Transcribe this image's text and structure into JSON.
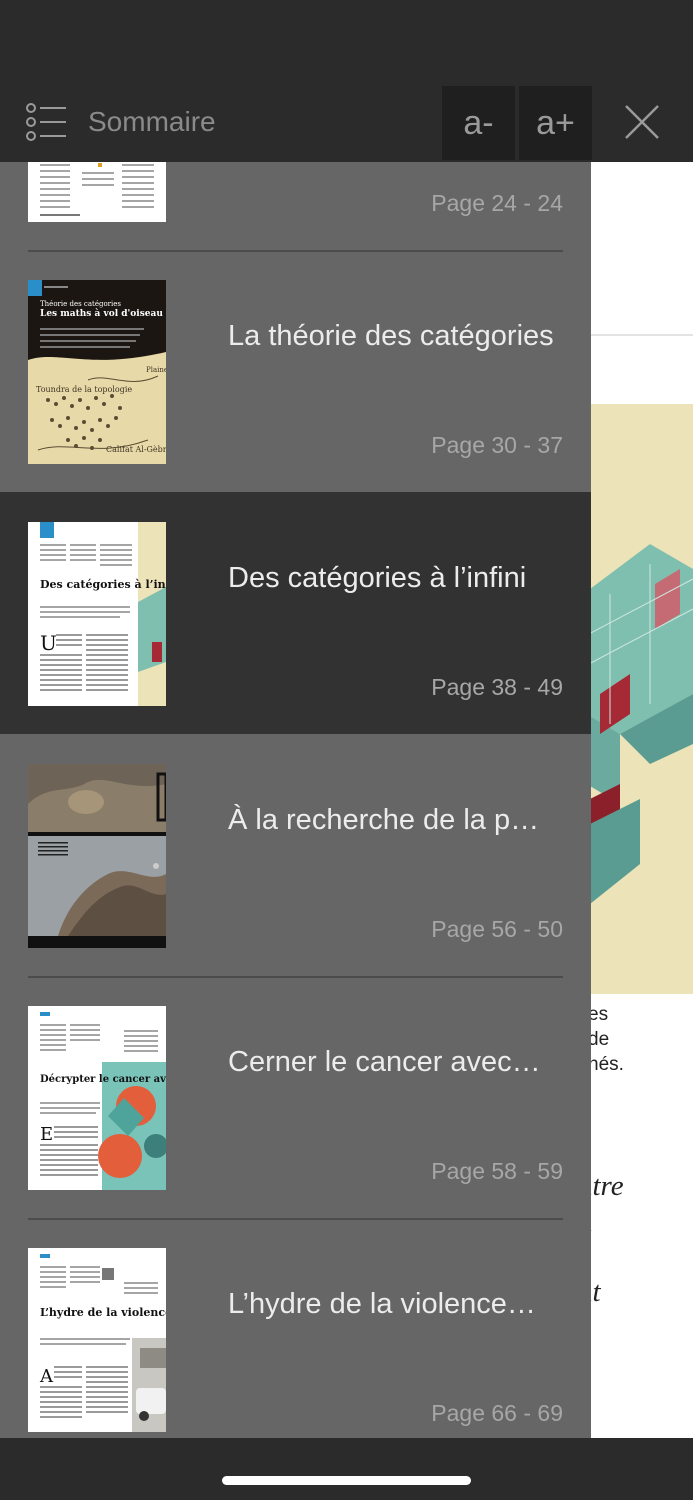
{
  "header": {
    "title": "Sommaire",
    "font_decrease": "a-",
    "font_increase": "a+"
  },
  "toc": [
    {
      "title": "",
      "pages": "Page 24 - 24"
    },
    {
      "title": "La théorie des catégories",
      "pages": "Page 30 - 37",
      "thumb": {
        "badge": "À LA UNE",
        "kicker": "Théorie des catégories",
        "headline": "Les maths à vol d'oiseau",
        "map_labels": [
          "Toundra de la topologie",
          "Califat Al-Gèbre",
          "Plaine"
        ]
      }
    },
    {
      "title": "Des catégories à l’infini",
      "pages": "Page 38 - 49",
      "selected": true,
      "thumb": {
        "badge": "À LA UNE",
        "headline": "Des catégories à l’infini",
        "dropcap": "U"
      }
    },
    {
      "title": "À la recherche de la p…",
      "pages": "Page 56 - 50"
    },
    {
      "title": "Cerner le cancer avec…",
      "pages": "Page 58 - 59",
      "thumb": {
        "headline": "Décrypter le cancer avec des prises de sang",
        "dropcap": "E"
      }
    },
    {
      "title": "L’hydre de la violence…",
      "pages": "Page 66 - 69",
      "thumb": {
        "headline": "L’hydre de la violence humaine",
        "dropcap": "A"
      }
    }
  ],
  "background_text": {
    "lines1": [
      "es",
      "de",
      "nés."
    ],
    "lines2": [
      "ntre",
      "n"
    ],
    "lines3": [
      "nt",
      "s"
    ]
  },
  "colors": {
    "panel": "#666666",
    "selected": "#323232",
    "bar": "#2b2b2b"
  }
}
